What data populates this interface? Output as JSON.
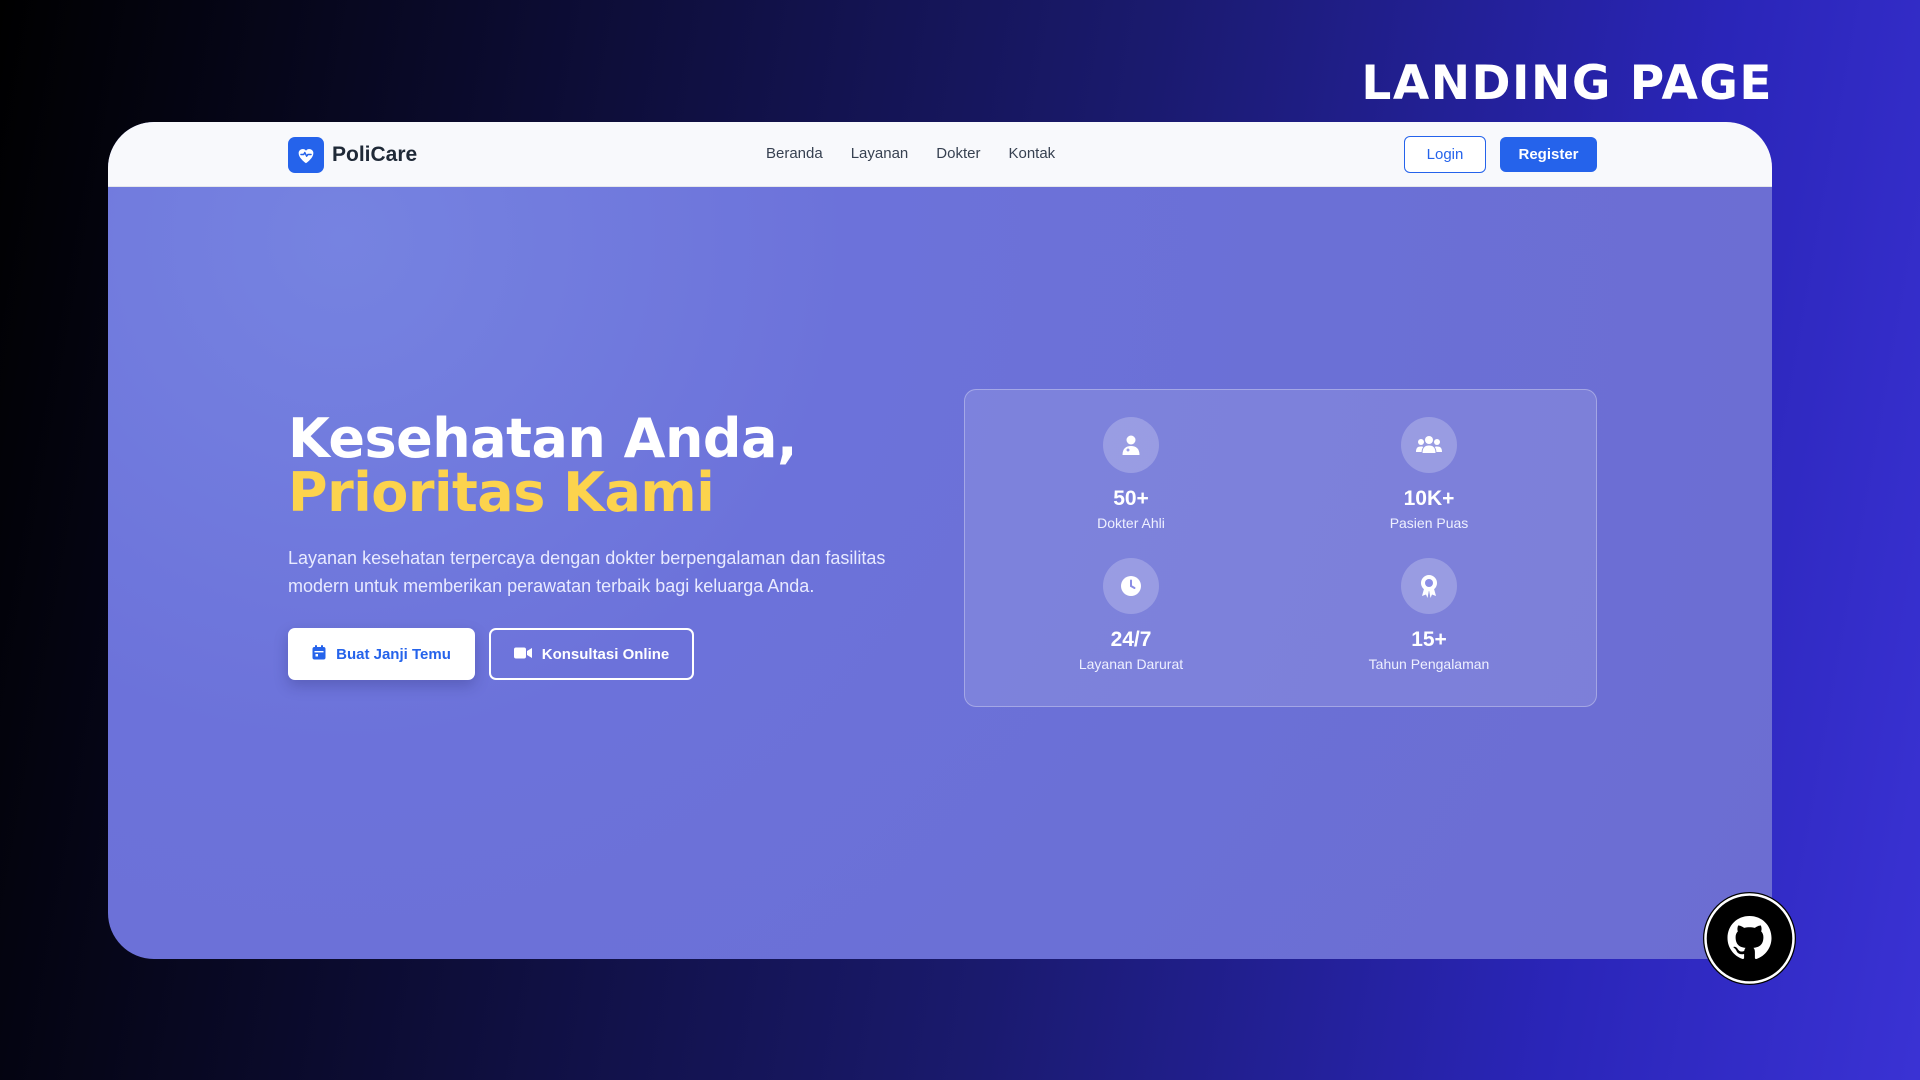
{
  "outer_title": "LANDING PAGE",
  "navbar": {
    "brand": "PoliCare",
    "links": [
      "Beranda",
      "Layanan",
      "Dokter",
      "Kontak"
    ],
    "login_label": "Login",
    "register_label": "Register"
  },
  "hero": {
    "title_line1": "Kesehatan Anda,",
    "title_line2": "Prioritas Kami",
    "description": "Layanan kesehatan terpercaya dengan dokter berpengalaman dan fasilitas modern untuk memberikan perawatan terbaik bagi keluarga Anda.",
    "primary_button": "Buat Janji Temu",
    "secondary_button": "Konsultasi Online"
  },
  "stats": [
    {
      "value": "50+",
      "label": "Dokter Ahli",
      "icon": "doctor-icon"
    },
    {
      "value": "10K+",
      "label": "Pasien Puas",
      "icon": "users-icon"
    },
    {
      "value": "24/7",
      "label": "Layanan Darurat",
      "icon": "clock-icon"
    },
    {
      "value": "15+",
      "label": "Tahun Pengalaman",
      "icon": "award-icon"
    }
  ],
  "colors": {
    "primary": "#2563eb",
    "accent_yellow": "#fcd34d",
    "hero_bg": "#6c72da"
  }
}
